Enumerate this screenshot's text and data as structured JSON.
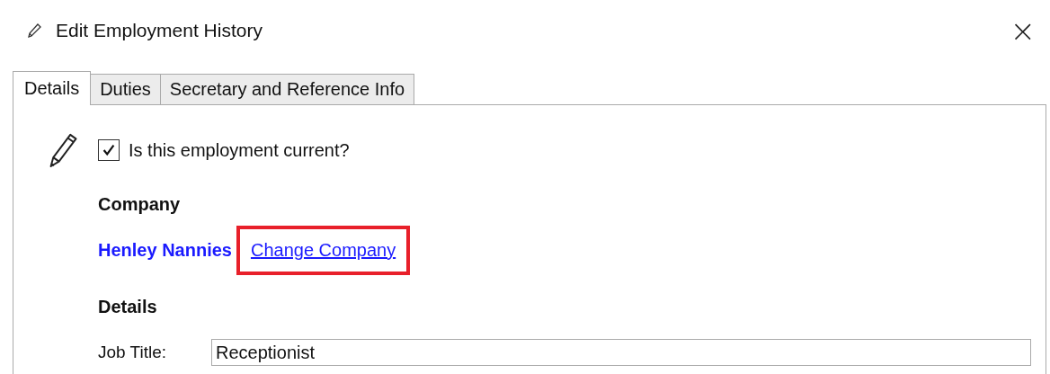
{
  "window": {
    "title": "Edit Employment History",
    "close": "×"
  },
  "tabs": [
    {
      "label": "Details",
      "selected": true
    },
    {
      "label": "Duties",
      "selected": false
    },
    {
      "label": "Secretary and Reference Info",
      "selected": false
    }
  ],
  "current": {
    "label": "Is this employment current?",
    "checked": true
  },
  "company": {
    "heading": "Company",
    "name": "Henley Nannies",
    "change_link": {
      "label": "Change Company",
      "highlighted": true
    }
  },
  "details": {
    "heading": "Details",
    "fields": [
      {
        "label": "Job Title:",
        "value": "Receptionist"
      }
    ]
  }
}
